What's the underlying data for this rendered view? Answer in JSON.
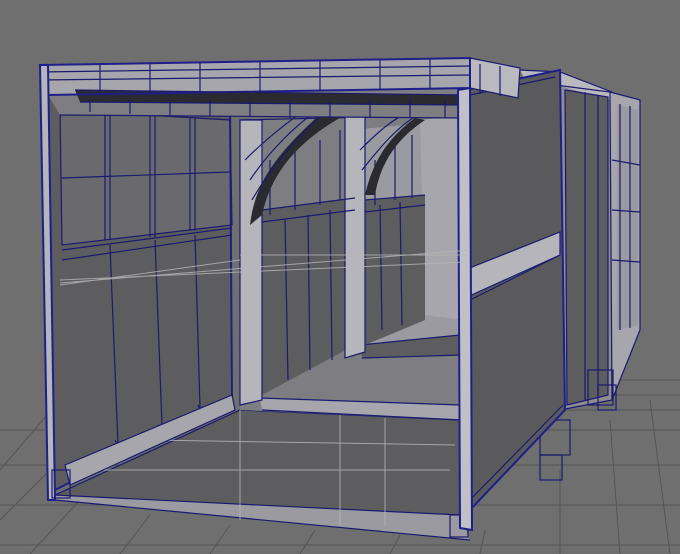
{
  "viewport": {
    "background": "#6e6e6e",
    "grid_color": "#505050",
    "wire_color": "#1a1a7a",
    "shade_light": "#a6a6ac",
    "shade_mid": "#8d8d92",
    "shade_dark": "#5d5d60"
  }
}
